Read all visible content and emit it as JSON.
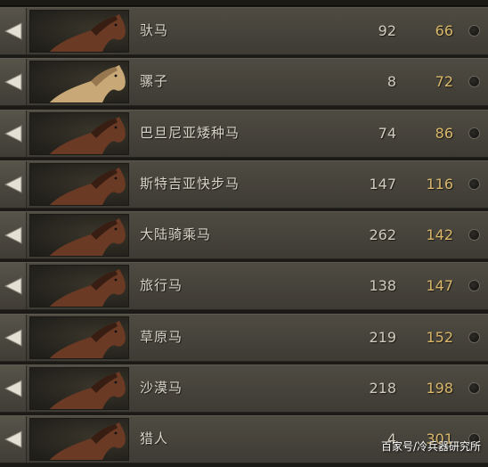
{
  "horses": [
    {
      "name": "驮马",
      "stat1": "92",
      "stat2": "66",
      "coat": "brown"
    },
    {
      "name": "骡子",
      "stat1": "8",
      "stat2": "72",
      "coat": "tan"
    },
    {
      "name": "巴旦尼亚矮种马",
      "stat1": "74",
      "stat2": "86",
      "coat": "brown"
    },
    {
      "name": "斯特吉亚快步马",
      "stat1": "147",
      "stat2": "116",
      "coat": "brown"
    },
    {
      "name": "大陆骑乘马",
      "stat1": "262",
      "stat2": "142",
      "coat": "brown"
    },
    {
      "name": "旅行马",
      "stat1": "138",
      "stat2": "147",
      "coat": "brown"
    },
    {
      "name": "草原马",
      "stat1": "219",
      "stat2": "152",
      "coat": "brown"
    },
    {
      "name": "沙漠马",
      "stat1": "218",
      "stat2": "198",
      "coat": "brown"
    },
    {
      "name": "猎人",
      "stat1": "4",
      "stat2": "301",
      "coat": "brown"
    }
  ],
  "watermark": "百家号/冷兵器研究所",
  "colors": {
    "stat2": "#d9b66a",
    "text": "#d8d4c8",
    "coat_brown": "#6a3a25",
    "coat_tan": "#c9a878"
  },
  "icons": {
    "row_button": "left-triangle-icon",
    "select": "radio-button"
  }
}
